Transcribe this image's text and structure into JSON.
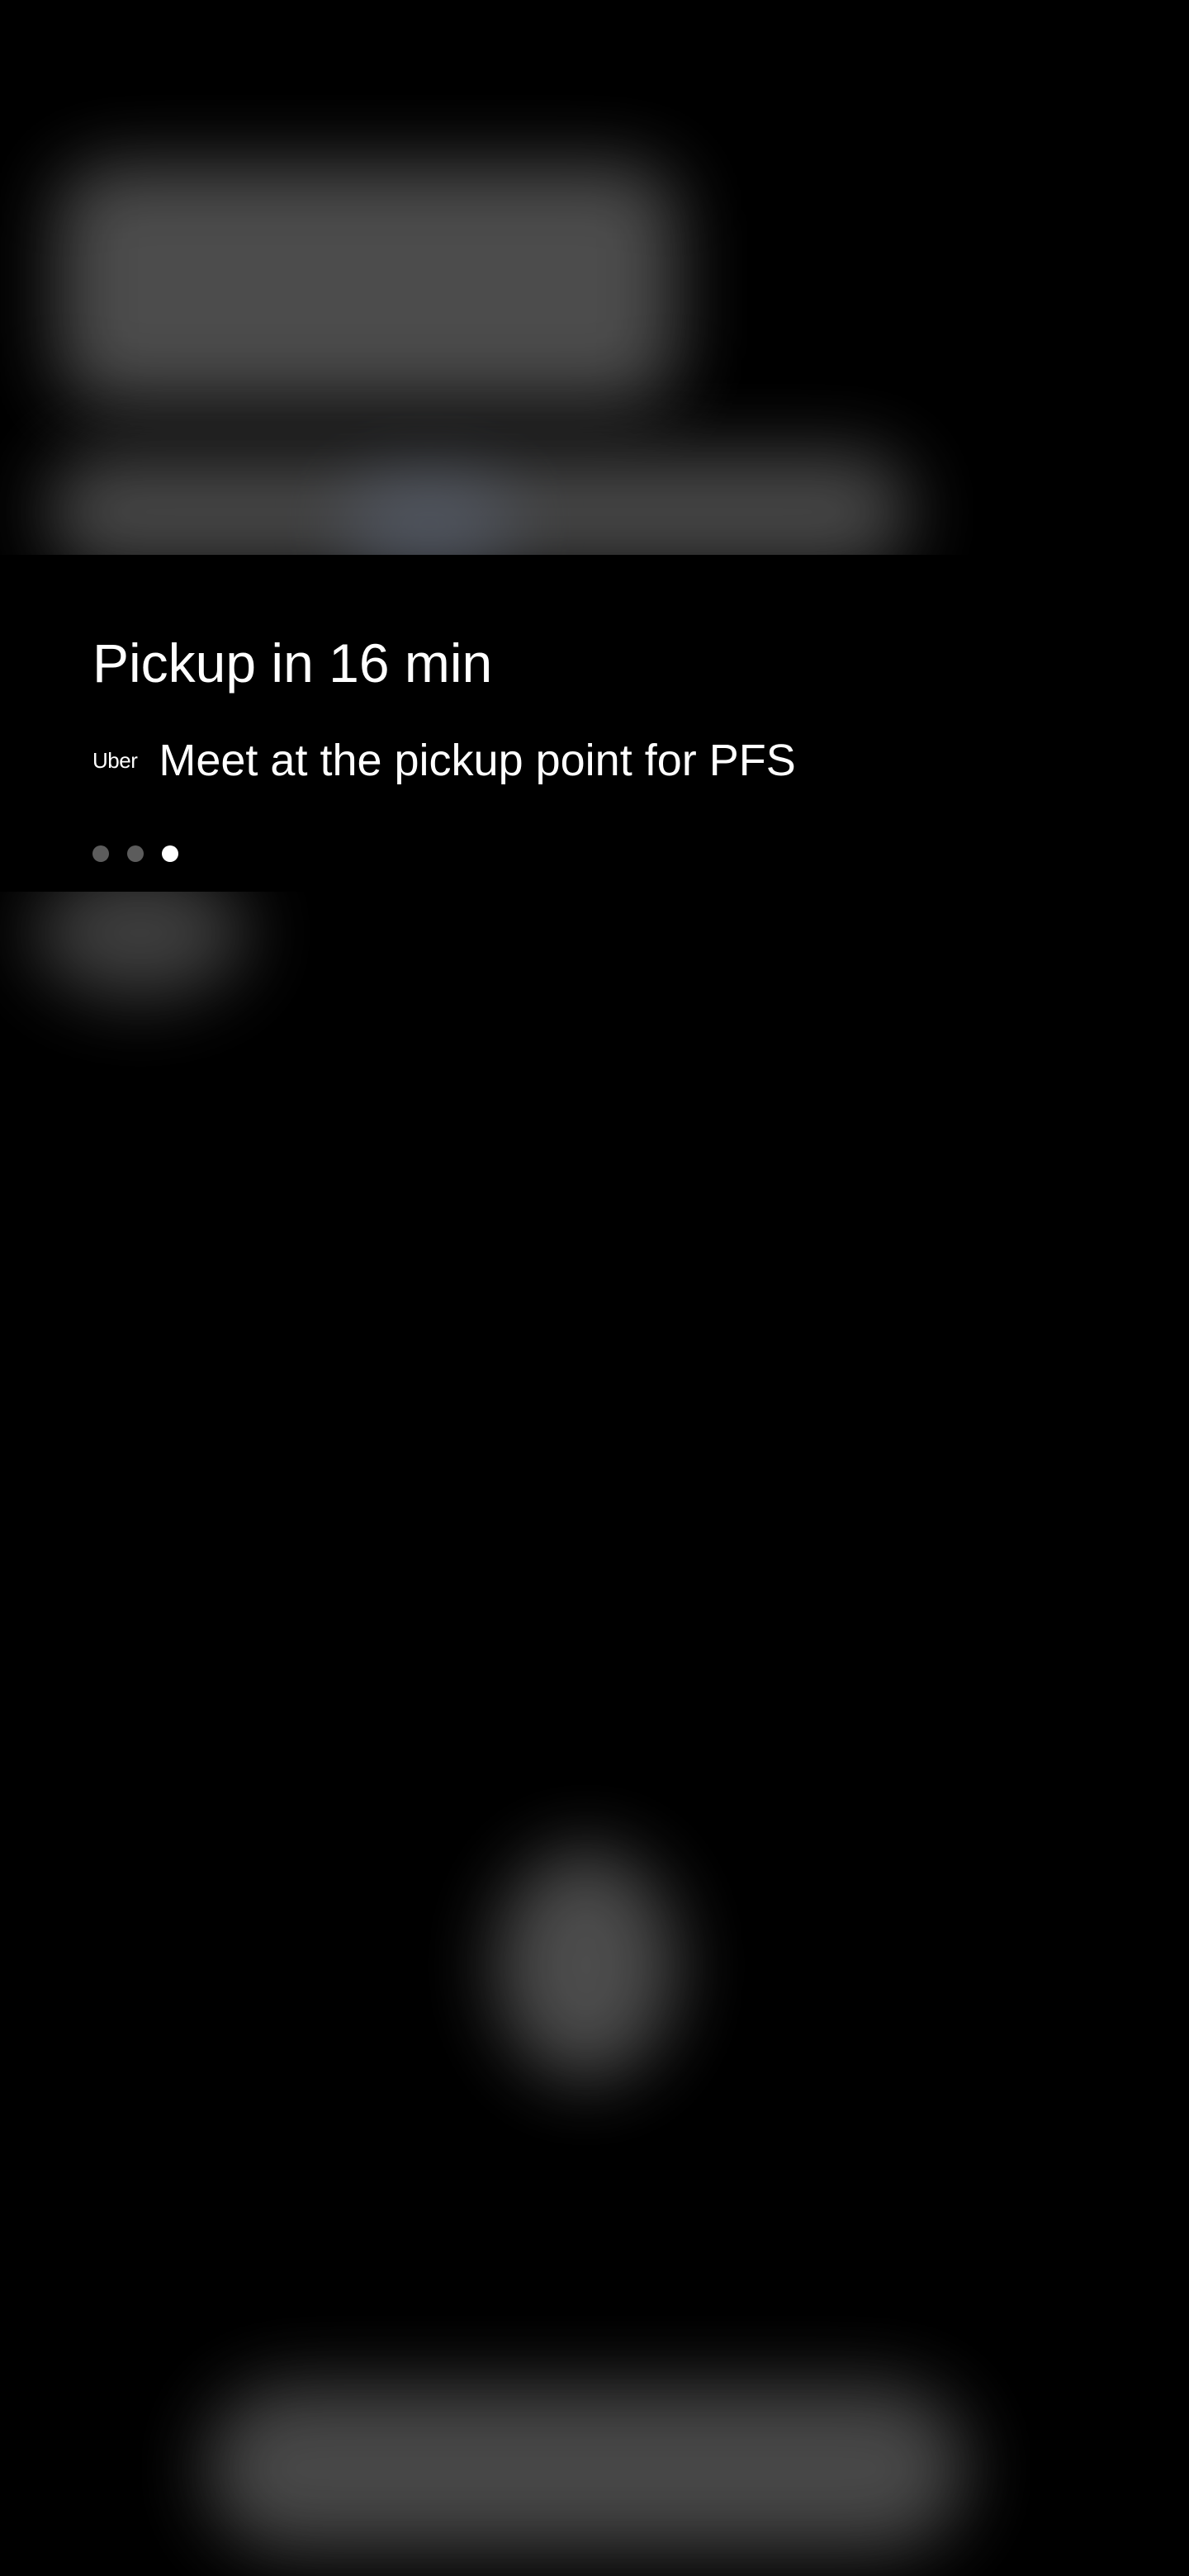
{
  "notification": {
    "title": "Pickup in 16 min",
    "app_logo_text": "Uber",
    "message": "Meet at the pickup point for PFS",
    "page_indicator": {
      "total": 3,
      "active_index": 2
    }
  },
  "colors": {
    "background": "#000000",
    "text": "#ffffff",
    "dot_inactive": "#5c5c5c",
    "dot_active": "#ffffff"
  }
}
